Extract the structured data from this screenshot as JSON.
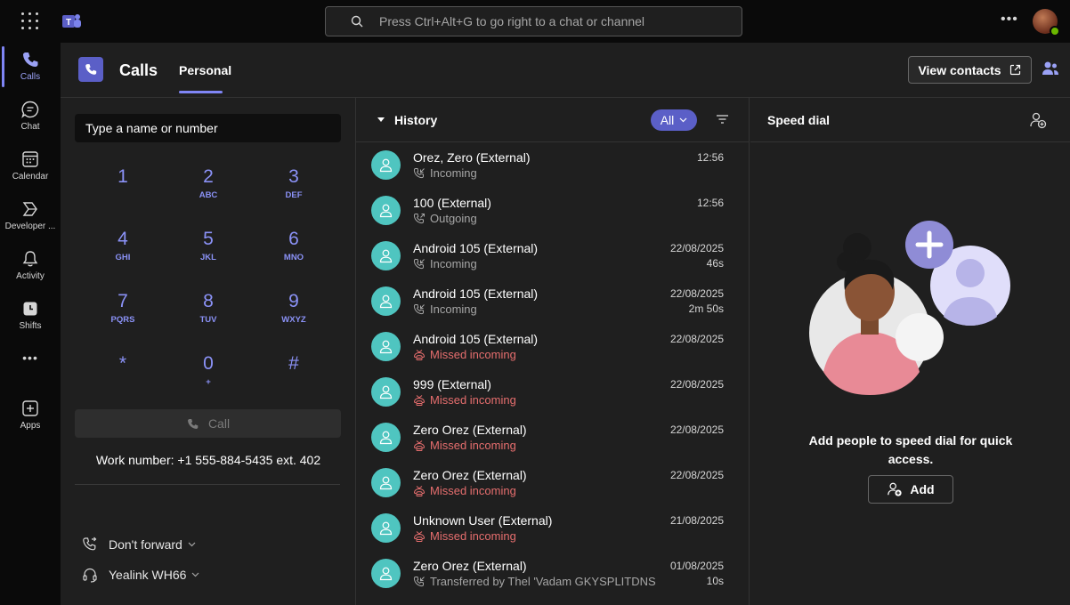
{
  "topbar": {
    "search_placeholder": "Press Ctrl+Alt+G to go right to a chat or channel",
    "more_label": "•••"
  },
  "rail": {
    "items": [
      {
        "label": "Calls",
        "icon": "phone-icon"
      },
      {
        "label": "Chat",
        "icon": "chat-icon"
      },
      {
        "label": "Calendar",
        "icon": "calendar-icon"
      },
      {
        "label": "Developer ...",
        "icon": "developer-icon"
      },
      {
        "label": "Activity",
        "icon": "bell-icon"
      },
      {
        "label": "Shifts",
        "icon": "shifts-icon"
      },
      {
        "label": "•••",
        "icon": "more-icon"
      },
      {
        "label": "Apps",
        "icon": "apps-icon"
      }
    ]
  },
  "header": {
    "title": "Calls",
    "tab": "Personal",
    "view_contacts": "View contacts"
  },
  "dialpad": {
    "input_placeholder": "Type a name or number",
    "keys": [
      {
        "digit": "1",
        "letters": ""
      },
      {
        "digit": "2",
        "letters": "ABC"
      },
      {
        "digit": "3",
        "letters": "DEF"
      },
      {
        "digit": "4",
        "letters": "GHI"
      },
      {
        "digit": "5",
        "letters": "JKL"
      },
      {
        "digit": "6",
        "letters": "MNO"
      },
      {
        "digit": "7",
        "letters": "PQRS"
      },
      {
        "digit": "8",
        "letters": "TUV"
      },
      {
        "digit": "9",
        "letters": "WXYZ"
      },
      {
        "digit": "*",
        "letters": ""
      },
      {
        "digit": "0",
        "letters": "+"
      },
      {
        "digit": "#",
        "letters": ""
      }
    ],
    "call_label": "Call",
    "work_number": "Work number: +1 555-884-5435 ext. 402",
    "forward_label": "Don't forward",
    "device_label": "Yealink WH66"
  },
  "history": {
    "title": "History",
    "filter_label": "All",
    "rows": [
      {
        "name": "Orez, Zero (External)",
        "status": "Incoming",
        "type": "incoming",
        "time": "12:56",
        "duration": ""
      },
      {
        "name": "100 (External)",
        "status": "Outgoing",
        "type": "outgoing",
        "time": "12:56",
        "duration": ""
      },
      {
        "name": "Android 105 (External)",
        "status": "Incoming",
        "type": "incoming",
        "time": "22/08/2025",
        "duration": "46s"
      },
      {
        "name": "Android 105 (External)",
        "status": "Incoming",
        "type": "incoming",
        "time": "22/08/2025",
        "duration": "2m 50s"
      },
      {
        "name": "Android 105 (External)",
        "status": "Missed incoming",
        "type": "missed",
        "time": "22/08/2025",
        "duration": ""
      },
      {
        "name": "999 (External)",
        "status": "Missed incoming",
        "type": "missed",
        "time": "22/08/2025",
        "duration": ""
      },
      {
        "name": "Zero Orez (External)",
        "status": "Missed incoming",
        "type": "missed",
        "time": "22/08/2025",
        "duration": ""
      },
      {
        "name": "Zero Orez (External)",
        "status": "Missed incoming",
        "type": "missed",
        "time": "22/08/2025",
        "duration": ""
      },
      {
        "name": "Unknown User (External)",
        "status": "Missed incoming",
        "type": "missed",
        "time": "21/08/2025",
        "duration": ""
      },
      {
        "name": "Zero Orez (External)",
        "status": "Transferred by Thel 'Vadam GKYSPLITDNS",
        "type": "transferred",
        "time": "01/08/2025",
        "duration": "10s"
      }
    ]
  },
  "speed_dial": {
    "title": "Speed dial",
    "message": "Add people to speed dial for quick access.",
    "add_label": "Add"
  },
  "colors": {
    "accent": "#7f85f5",
    "brand": "#5b5fc7",
    "avatar": "#4fc5c0",
    "missed": "#e66e6e"
  }
}
